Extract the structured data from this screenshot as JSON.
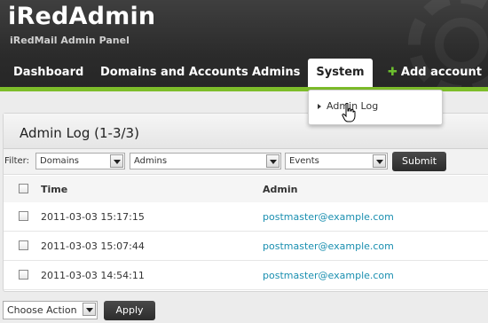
{
  "app": {
    "title": "iRedAdmin",
    "subtitle": "iRedMail Admin Panel"
  },
  "nav": {
    "items": [
      {
        "label": "Dashboard"
      },
      {
        "label": "Domains and Accounts"
      },
      {
        "label": "Admins"
      },
      {
        "label": "System"
      },
      {
        "label": "Add account",
        "icon": "plus-icon"
      }
    ],
    "active": "System"
  },
  "system_menu": {
    "items": [
      {
        "label": "Admin Log"
      }
    ]
  },
  "panel": {
    "title": "Admin Log (1-3/3)"
  },
  "filter": {
    "label": "Filter:",
    "domains": "Domains",
    "admins": "Admins",
    "events": "Events",
    "submit": "Submit"
  },
  "table": {
    "headers": {
      "time": "Time",
      "admin": "Admin"
    },
    "rows": [
      {
        "time": "2011-03-03 15:17:15",
        "admin": "postmaster@example.com"
      },
      {
        "time": "2011-03-03 15:07:44",
        "admin": "postmaster@example.com"
      },
      {
        "time": "2011-03-03 14:54:11",
        "admin": "postmaster@example.com"
      }
    ]
  },
  "footer": {
    "action_select": "Choose Action",
    "apply": "Apply"
  },
  "colors": {
    "accent_green": "#7dbd2a",
    "link_blue": "#1a8fb0",
    "header_dark": "#2b2b2b"
  }
}
